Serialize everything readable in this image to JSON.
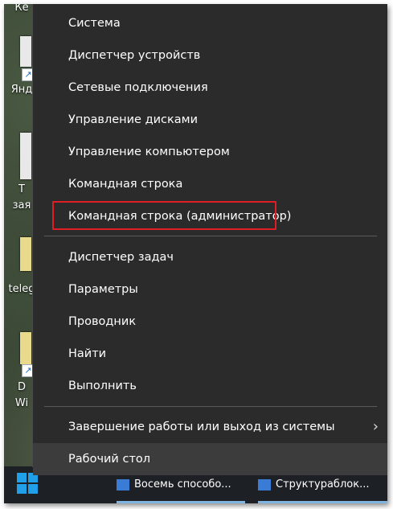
{
  "desktop": {
    "icons": [
      {
        "label": "Ке"
      },
      {
        "label": "Янд"
      },
      {
        "label": "Т"
      },
      {
        "label": "зая"
      },
      {
        "label": "teleg"
      },
      {
        "label": "D"
      },
      {
        "label": "Wi"
      }
    ]
  },
  "menu": {
    "items": [
      {
        "label": "Система"
      },
      {
        "label": "Диспетчер устройств"
      },
      {
        "label": "Сетевые подключения"
      },
      {
        "label": "Управление дисками"
      },
      {
        "label": "Управление компьютером"
      },
      {
        "label": "Командная строка"
      },
      {
        "label": "Командная строка (администратор)"
      },
      {
        "label": "Диспетчер задач"
      },
      {
        "label": "Параметры"
      },
      {
        "label": "Проводник"
      },
      {
        "label": "Найти"
      },
      {
        "label": "Выполнить"
      },
      {
        "label": "Завершение работы или выход из системы"
      },
      {
        "label": "Рабочий стол"
      }
    ],
    "highlight_color": "#e01d24"
  },
  "taskbar": {
    "apps": [
      {
        "label": "Восемь способо..."
      },
      {
        "label": "Структураблок..."
      }
    ],
    "accent": "#1fa0e8"
  }
}
